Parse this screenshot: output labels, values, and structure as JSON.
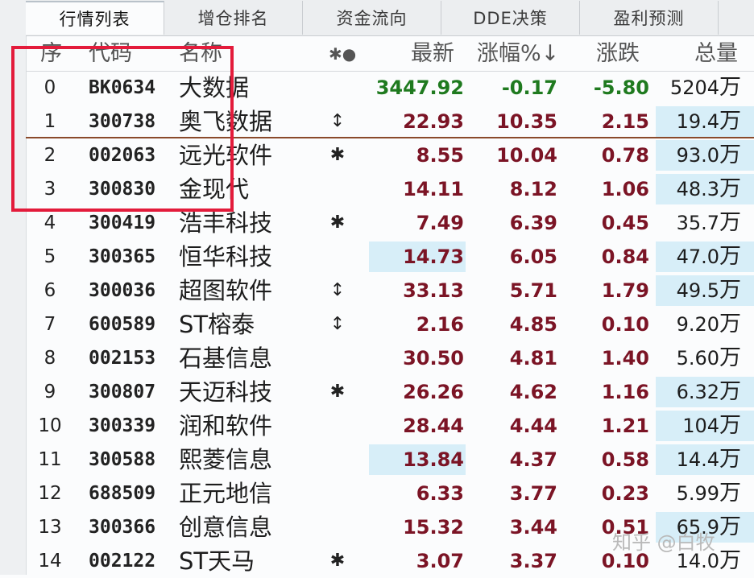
{
  "tabs": [
    "行情列表",
    "增仓排名",
    "资金流向",
    "DDE决策",
    "盈利预测"
  ],
  "columns": {
    "idx": "序",
    "code": "代码",
    "name": "名称",
    "icon": "✱●",
    "price": "最新",
    "pct": "涨幅%↓",
    "chg": "涨跌",
    "vol": "总量"
  },
  "rows": [
    {
      "idx": "0",
      "code": "BK0634",
      "name": "大数据",
      "icon": "",
      "price": "3447.92",
      "pct": "-0.17",
      "chg": "-5.80",
      "vol": "5204",
      "unit": "万",
      "tone": "down",
      "hl_price": false,
      "hl_vol": false
    },
    {
      "idx": "1",
      "code": "300738",
      "name": "奥飞数据",
      "icon": "↕",
      "price": "22.93",
      "pct": "10.35",
      "chg": "2.15",
      "vol": "19.4",
      "unit": "万",
      "tone": "up",
      "hl_price": false,
      "hl_vol": true
    },
    {
      "idx": "2",
      "code": "002063",
      "name": "远光软件",
      "icon": "✱",
      "price": "8.55",
      "pct": "10.04",
      "chg": "0.78",
      "vol": "93.0",
      "unit": "万",
      "tone": "up",
      "hl_price": false,
      "hl_vol": true
    },
    {
      "idx": "3",
      "code": "300830",
      "name": "金现代",
      "icon": "",
      "price": "14.11",
      "pct": "8.12",
      "chg": "1.06",
      "vol": "48.3",
      "unit": "万",
      "tone": "up",
      "hl_price": false,
      "hl_vol": true
    },
    {
      "idx": "4",
      "code": "300419",
      "name": "浩丰科技",
      "icon": "✱",
      "price": "7.49",
      "pct": "6.39",
      "chg": "0.45",
      "vol": "35.7",
      "unit": "万",
      "tone": "up",
      "hl_price": false,
      "hl_vol": false
    },
    {
      "idx": "5",
      "code": "300365",
      "name": "恒华科技",
      "icon": "",
      "price": "14.73",
      "pct": "6.05",
      "chg": "0.84",
      "vol": "47.0",
      "unit": "万",
      "tone": "up",
      "hl_price": true,
      "hl_vol": true
    },
    {
      "idx": "6",
      "code": "300036",
      "name": "超图软件",
      "icon": "↕",
      "price": "33.13",
      "pct": "5.71",
      "chg": "1.79",
      "vol": "49.5",
      "unit": "万",
      "tone": "up",
      "hl_price": false,
      "hl_vol": true
    },
    {
      "idx": "7",
      "code": "600589",
      "name": "ST榕泰",
      "icon": "↕",
      "price": "2.16",
      "pct": "4.85",
      "chg": "0.10",
      "vol": "9.20",
      "unit": "万",
      "tone": "up",
      "hl_price": false,
      "hl_vol": false
    },
    {
      "idx": "8",
      "code": "002153",
      "name": "石基信息",
      "icon": "",
      "price": "30.50",
      "pct": "4.81",
      "chg": "1.40",
      "vol": "5.60",
      "unit": "万",
      "tone": "up",
      "hl_price": false,
      "hl_vol": false
    },
    {
      "idx": "9",
      "code": "300807",
      "name": "天迈科技",
      "icon": "✱",
      "price": "26.26",
      "pct": "4.62",
      "chg": "1.16",
      "vol": "6.32",
      "unit": "万",
      "tone": "up",
      "hl_price": false,
      "hl_vol": true
    },
    {
      "idx": "10",
      "code": "300339",
      "name": "润和软件",
      "icon": "",
      "price": "28.44",
      "pct": "4.44",
      "chg": "1.21",
      "vol": "104",
      "unit": "万",
      "tone": "up",
      "hl_price": false,
      "hl_vol": true
    },
    {
      "idx": "11",
      "code": "300588",
      "name": "熙菱信息",
      "icon": "",
      "price": "13.84",
      "pct": "4.37",
      "chg": "0.58",
      "vol": "14.4",
      "unit": "万",
      "tone": "up",
      "hl_price": true,
      "hl_vol": true
    },
    {
      "idx": "12",
      "code": "688509",
      "name": "正元地信",
      "icon": "",
      "price": "6.33",
      "pct": "3.77",
      "chg": "0.23",
      "vol": "5.99",
      "unit": "万",
      "tone": "up",
      "hl_price": false,
      "hl_vol": false
    },
    {
      "idx": "13",
      "code": "300366",
      "name": "创意信息",
      "icon": "",
      "price": "15.32",
      "pct": "3.44",
      "chg": "0.51",
      "vol": "65.9",
      "unit": "万",
      "tone": "up",
      "hl_price": false,
      "hl_vol": true
    },
    {
      "idx": "14",
      "code": "002122",
      "name": "ST天马",
      "icon": "✱",
      "price": "3.07",
      "pct": "3.37",
      "chg": "0.10",
      "vol": "14.0",
      "unit": "万",
      "tone": "up",
      "hl_price": false,
      "hl_vol": false
    }
  ],
  "watermark": "知乎 @白牧",
  "colors": {
    "up": "#7b1425",
    "down": "#1f7a1f",
    "highlight": "#d7eef8",
    "annotation_box": "#e31b3b"
  }
}
